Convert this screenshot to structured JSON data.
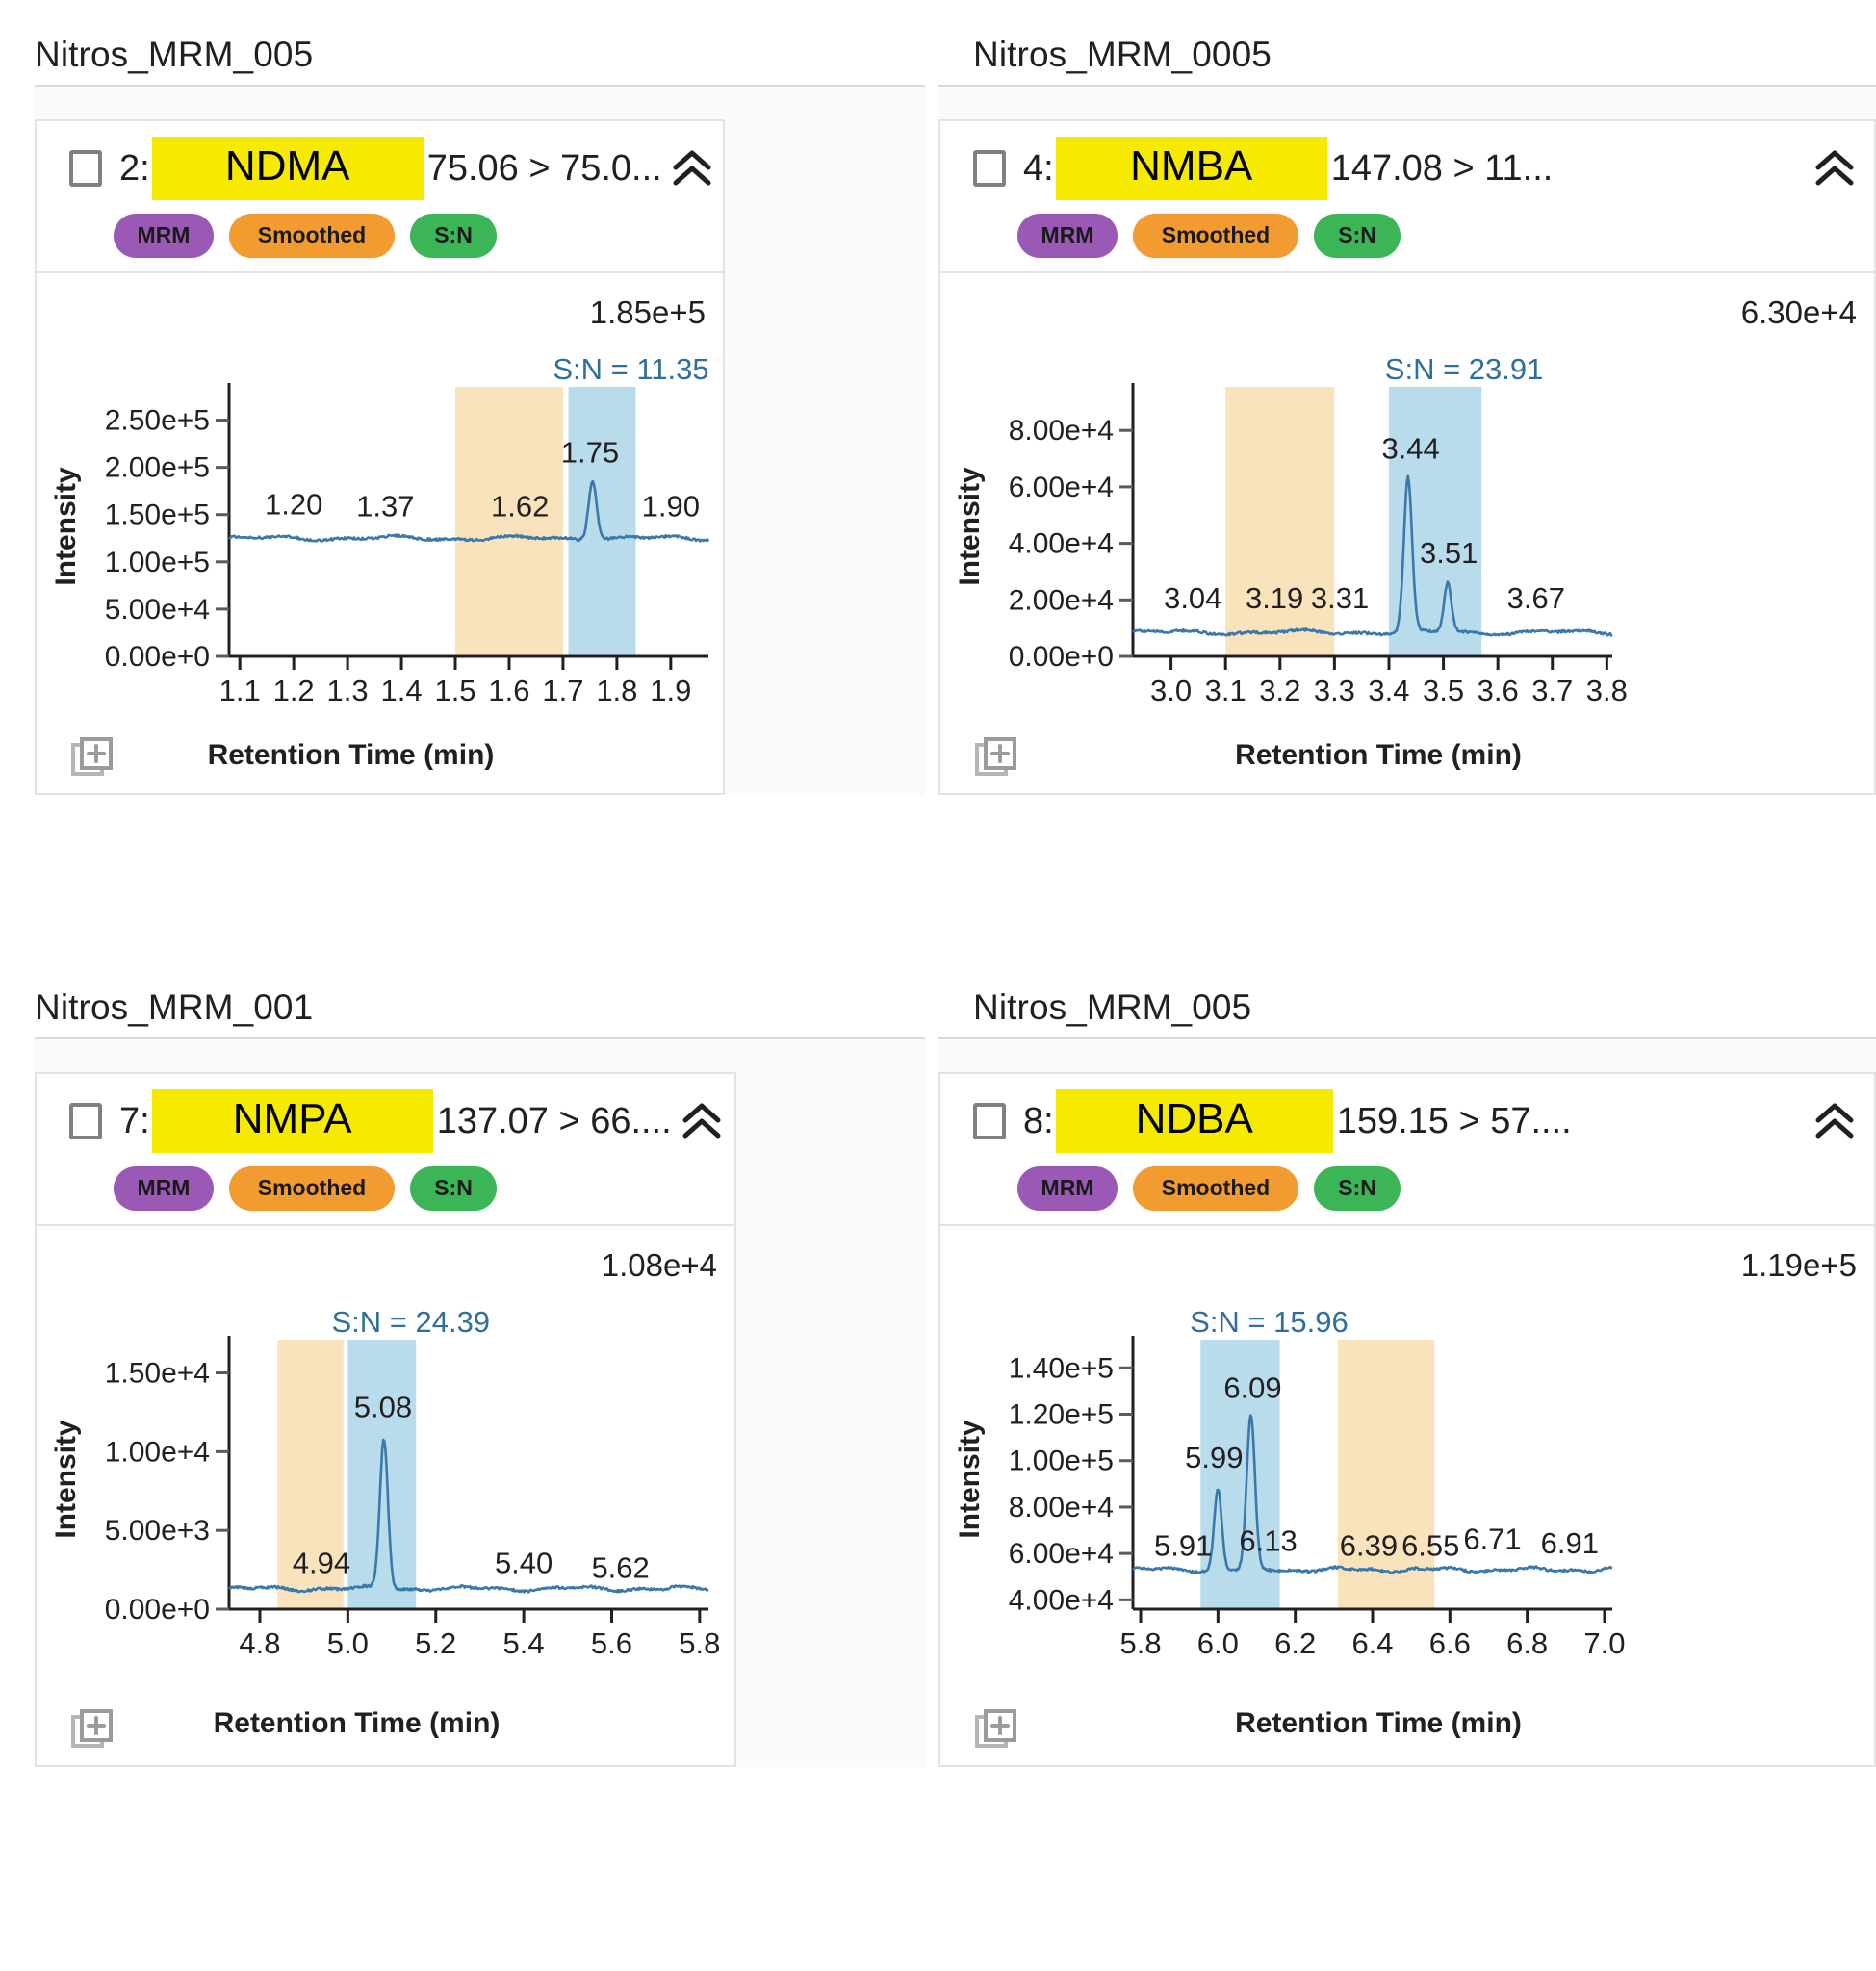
{
  "panels": [
    {
      "file_title": "Nitros_MRM_005",
      "index_label": "2:",
      "analyte": "NDMA",
      "transition": "75.06 > 75.0...",
      "collapse_icon": "chevron-double-up-icon",
      "tags": {
        "mrm": "MRM",
        "smoothed": "Smoothed",
        "sn": "S:N"
      },
      "chart_data": {
        "type": "line",
        "title": "NDMA",
        "ymax_annotation": "1.85e+5",
        "sn_annotation": "S:N = 11.35",
        "xlabel": "Retention Time (min)",
        "ylabel": "Intensity",
        "xticks": [
          "1.1",
          "1.2",
          "1.3",
          "1.4",
          "1.5",
          "1.6",
          "1.7",
          "1.8",
          "1.9"
        ],
        "yticks": [
          "0.00e+0",
          "5.00e+4",
          "1.00e+5",
          "1.50e+5",
          "2.00e+5",
          "2.50e+5"
        ],
        "xlim": [
          1.08,
          1.97
        ],
        "ylim": [
          0,
          275000
        ],
        "integration_region": {
          "start": 1.5,
          "end": 1.7,
          "color": "#f8e3bd"
        },
        "sn_region": {
          "start": 1.71,
          "end": 1.835,
          "color": "#b8dceb"
        },
        "peak_labels": [
          {
            "x": 1.2,
            "y": 150000,
            "text": "1.20"
          },
          {
            "x": 1.37,
            "y": 148000,
            "text": "1.37"
          },
          {
            "x": 1.62,
            "y": 148000,
            "text": "1.62"
          },
          {
            "x": 1.75,
            "y": 205000,
            "text": "1.75"
          },
          {
            "x": 1.9,
            "y": 148000,
            "text": "1.90"
          }
        ],
        "baseline": 125000,
        "apex": {
          "x": 1.755,
          "y": 188000
        },
        "grid": false,
        "line_color": "#3a78ab"
      }
    },
    {
      "file_title": "Nitros_MRM_0005",
      "index_label": "4:",
      "analyte": "NMBA",
      "transition": "147.08 > 11...",
      "collapse_icon": "chevron-double-up-icon",
      "tags": {
        "mrm": "MRM",
        "smoothed": "Smoothed",
        "sn": "S:N"
      },
      "chart_data": {
        "type": "line",
        "title": "NMBA",
        "ymax_annotation": "6.30e+4",
        "sn_annotation": "S:N = 23.91",
        "xlabel": "Retention Time (min)",
        "ylabel": "Intensity",
        "xticks": [
          "3.0",
          "3.1",
          "3.2",
          "3.3",
          "3.4",
          "3.5",
          "3.6",
          "3.7",
          "3.8"
        ],
        "yticks": [
          "0.00e+0",
          "2.00e+4",
          "4.00e+4",
          "6.00e+4",
          "8.00e+4"
        ],
        "xlim": [
          2.93,
          3.81
        ],
        "ylim": [
          0,
          92000
        ],
        "integration_region": {
          "start": 3.1,
          "end": 3.3,
          "color": "#f8e3bd"
        },
        "sn_region": {
          "start": 3.4,
          "end": 3.57,
          "color": "#b8dceb"
        },
        "peak_labels": [
          {
            "x": 3.04,
            "y": 17000,
            "text": "3.04"
          },
          {
            "x": 3.19,
            "y": 17000,
            "text": "3.19"
          },
          {
            "x": 3.31,
            "y": 17000,
            "text": "3.31"
          },
          {
            "x": 3.44,
            "y": 70000,
            "text": "3.44"
          },
          {
            "x": 3.51,
            "y": 33000,
            "text": "3.51"
          },
          {
            "x": 3.67,
            "y": 17000,
            "text": "3.67"
          }
        ],
        "baseline": 8500,
        "apex": {
          "x": 3.435,
          "y": 63000
        },
        "second_apex": {
          "x": 3.508,
          "y": 26000
        },
        "grid": false,
        "line_color": "#3a78ab"
      }
    },
    {
      "file_title": "Nitros_MRM_001",
      "index_label": "7:",
      "analyte": "NMPA",
      "transition": "137.07 > 66....",
      "collapse_icon": "chevron-double-up-icon",
      "tags": {
        "mrm": "MRM",
        "smoothed": "Smoothed",
        "sn": "S:N"
      },
      "chart_data": {
        "type": "line",
        "title": "NMPA",
        "ymax_annotation": "1.08e+4",
        "sn_annotation": "S:N = 24.39",
        "xlabel": "Retention Time (min)",
        "ylabel": "Intensity",
        "xticks": [
          "4.8",
          "5.0",
          "5.2",
          "5.4",
          "5.6",
          "5.8"
        ],
        "yticks": [
          "0.00e+0",
          "5.00e+3",
          "1.00e+4",
          "1.50e+4"
        ],
        "xlim": [
          4.73,
          5.82
        ],
        "ylim": [
          0,
          16500
        ],
        "integration_region": {
          "start": 4.84,
          "end": 4.99,
          "color": "#f8e3bd"
        },
        "sn_region": {
          "start": 5.0,
          "end": 5.155,
          "color": "#b8dceb"
        },
        "peak_labels": [
          {
            "x": 4.94,
            "y": 2300,
            "text": "4.94"
          },
          {
            "x": 5.08,
            "y": 12200,
            "text": "5.08"
          },
          {
            "x": 5.4,
            "y": 2300,
            "text": "5.40"
          },
          {
            "x": 5.62,
            "y": 2000,
            "text": "5.62"
          }
        ],
        "baseline": 1300,
        "apex": {
          "x": 5.082,
          "y": 10800
        },
        "grid": false,
        "line_color": "#3a78ab"
      }
    },
    {
      "file_title": "Nitros_MRM_005",
      "index_label": "8:",
      "analyte": "NDBA",
      "transition": "159.15 > 57....",
      "collapse_icon": "chevron-double-up-icon",
      "tags": {
        "mrm": "MRM",
        "smoothed": "Smoothed",
        "sn": "S:N"
      },
      "chart_data": {
        "type": "line",
        "title": "NDBA",
        "ymax_annotation": "1.19e+5",
        "sn_annotation": "S:N = 15.96",
        "xlabel": "Retention Time (min)",
        "ylabel": "Intensity",
        "xticks": [
          "5.8",
          "6.0",
          "6.2",
          "6.4",
          "6.6",
          "6.8",
          "7.0"
        ],
        "yticks": [
          "4.00e+4",
          "6.00e+4",
          "8.00e+4",
          "1.00e+5",
          "1.20e+5",
          "1.40e+5"
        ],
        "xlim": [
          5.78,
          7.02
        ],
        "ylim": [
          36000,
          148000
        ],
        "integration_region": {
          "start": 6.31,
          "end": 6.56,
          "color": "#f8e3bd"
        },
        "sn_region": {
          "start": 5.955,
          "end": 6.16,
          "color": "#b8dceb"
        },
        "peak_labels": [
          {
            "x": 5.91,
            "y": 59000,
            "text": "5.91"
          },
          {
            "x": 5.99,
            "y": 97000,
            "text": "5.99"
          },
          {
            "x": 6.09,
            "y": 127000,
            "text": "6.09"
          },
          {
            "x": 6.13,
            "y": 61000,
            "text": "6.13"
          },
          {
            "x": 6.39,
            "y": 59000,
            "text": "6.39"
          },
          {
            "x": 6.55,
            "y": 59000,
            "text": "6.55"
          },
          {
            "x": 6.71,
            "y": 62000,
            "text": "6.71"
          },
          {
            "x": 6.91,
            "y": 60000,
            "text": "6.91"
          }
        ],
        "baseline": 53000,
        "apex": {
          "x": 6.085,
          "y": 119000
        },
        "second_apex": {
          "x": 6.0,
          "y": 88000
        },
        "grid": false,
        "line_color": "#3a78ab"
      }
    }
  ],
  "colors": {
    "highlight": "#f5ea00",
    "mrm_tag": "#9b59b6",
    "smoothed_tag": "#f29b30",
    "sn_tag": "#3cb557",
    "integration_band": "#f8e3bd",
    "sn_band": "#b8dceb",
    "trace": "#3a78ab"
  }
}
